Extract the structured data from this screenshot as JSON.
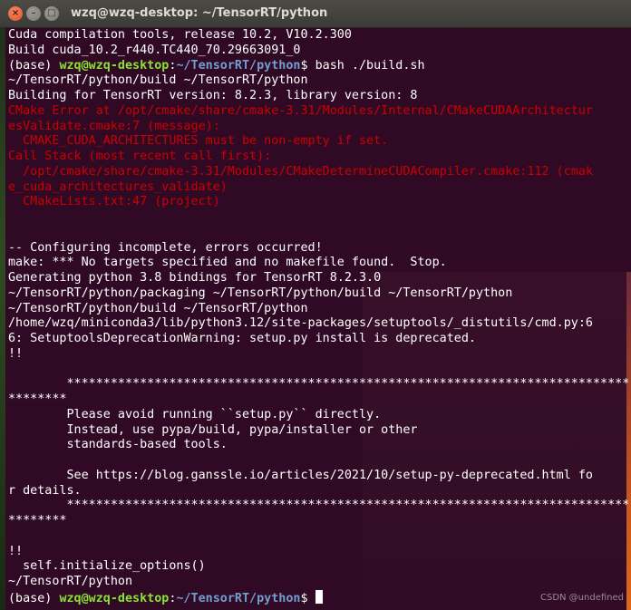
{
  "window": {
    "title": "wzq@wzq-desktop: ~/TensorRT/python",
    "controls": {
      "close_glyph": "×",
      "minimize_glyph": "–",
      "maximize_glyph": "□"
    }
  },
  "prompt": {
    "env": "(base) ",
    "userhost": "wzq@wzq-desktop",
    "sep": ":",
    "path": "~/TensorRT/python",
    "symbol": "$ ",
    "command": "bash ./build.sh"
  },
  "output": {
    "l02": "Cuda compilation tools, release 10.2, V10.2.300",
    "l03": "Build cuda_10.2_r440.TC440_70.29663091_0",
    "l05": "~/TensorRT/python/build ~/TensorRT/python",
    "l06": "Building for TensorRT version: 8.2.3, library version: 8",
    "l07": "CMake Error at /opt/cmake/share/cmake-3.31/Modules/Internal/CMakeCUDAArchitectur",
    "l08": "esValidate.cmake:7 (message):",
    "l09": "  CMAKE_CUDA_ARCHITECTURES must be non-empty if set.",
    "l10": "Call Stack (most recent call first):",
    "l11": "  /opt/cmake/share/cmake-3.31/Modules/CMakeDetermineCUDACompiler.cmake:112 (cmak",
    "l12": "e_cuda_architectures_validate)",
    "l13": "  CMakeLists.txt:47 (project)",
    "l14": "",
    "l15": "",
    "l16": "-- Configuring incomplete, errors occurred!",
    "l17": "make: *** No targets specified and no makefile found.  Stop.",
    "l18": "Generating python 3.8 bindings for TensorRT 8.2.3.0",
    "l19": "~/TensorRT/python/packaging ~/TensorRT/python/build ~/TensorRT/python",
    "l20": "~/TensorRT/python/build ~/TensorRT/python",
    "l21": "/home/wzq/miniconda3/lib/python3.12/site-packages/setuptools/_distutils/cmd.py:6",
    "l22": "6: SetuptoolsDeprecationWarning: setup.py install is deprecated.",
    "l23": "!!",
    "l24": "",
    "l25": "        ********************************************************************************",
    "l26": "********",
    "l27": "        Please avoid running ``setup.py`` directly.",
    "l28": "        Instead, use pypa/build, pypa/installer or other",
    "l29": "        standards-based tools.",
    "l30": "",
    "l31": "        See https://blog.ganssle.io/articles/2021/10/setup-py-deprecated.html fo",
    "l32": "r details.",
    "l33": "        ********************************************************************************",
    "l34": "********",
    "l35": "",
    "l36": "!!",
    "l37": "  self.initialize_options()",
    "l38": "~/TensorRT/python"
  },
  "watermark": "CSDN @undefined",
  "colors": {
    "background": "#300a24",
    "text": "#ffffff",
    "error": "#cc0000",
    "userhost": "#8ae234",
    "path": "#729fcf",
    "titlebar": "#3c3b37",
    "close_button": "#e0541d"
  }
}
